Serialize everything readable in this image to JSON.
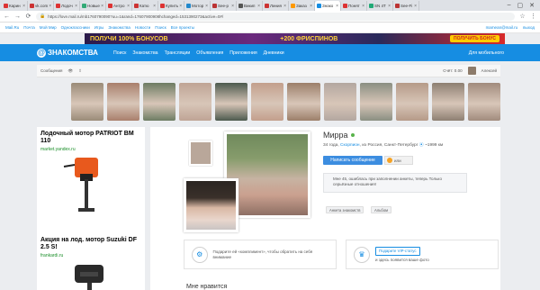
{
  "browser": {
    "tabs": [
      {
        "label": "Карин",
        "fav": "#d33"
      },
      {
        "label": "vk.com",
        "fav": "#c33"
      },
      {
        "label": "Лодоч",
        "fav": "#d33"
      },
      {
        "label": "Новые",
        "fav": "#3a7"
      },
      {
        "label": "Антро",
        "fav": "#d33"
      },
      {
        "label": "Катю",
        "fav": "#c33"
      },
      {
        "label": "Купить",
        "fav": "#d33"
      },
      {
        "label": "Мотор",
        "fav": "#28c"
      },
      {
        "label": "See-p",
        "fav": "#b33"
      },
      {
        "label": "Викип",
        "fav": "#555"
      },
      {
        "label": "Линия",
        "fav": "#c33"
      },
      {
        "label": "Заказ",
        "fav": "#f90"
      },
      {
        "label": "Знако",
        "fav": "#168de2"
      },
      {
        "label": "Понят",
        "fav": "#d33"
      },
      {
        "label": "SN 4Т",
        "fav": "#2a7"
      },
      {
        "label": "See-Fi",
        "fav": "#b33"
      }
    ],
    "url": "https://love.mail.ru/mb1760790090?uu=1&rand=17607900908hchanged=1531390273&active=0#/"
  },
  "portal": {
    "links": [
      "Mail.Ru",
      "Почта",
      "Мой Мир",
      "Одноклассники",
      "Игры",
      "Знакомства",
      "Новости",
      "Поиск",
      "Все проекты"
    ],
    "user": "mamean@mail.ru",
    "logout": "выход"
  },
  "banner": {
    "left": "ПОЛУЧИ 100% БОНУСОВ",
    "right": "+200 ФРИСПИНОВ",
    "button": "ПОЛУЧИТЬ БОНУС"
  },
  "nav": {
    "logo": "ЗНАКОМСТВА",
    "items": [
      "Поиск",
      "Знакомства",
      "Трансляции",
      "Объявления",
      "Приложения",
      "Дневники"
    ],
    "mobile": "Для мобильного"
  },
  "subbar": {
    "messages": "Сообщения",
    "balance": "Счёт: 0.00",
    "user": "Алексей"
  },
  "strip_colors": [
    "#9a8b78",
    "#a97f6c",
    "#6d7c63",
    "#bfa495",
    "#4c5a4e",
    "#c39f8c",
    "#9c7f6a",
    "#b3a7a0",
    "#8a8f82",
    "#b59a88",
    "#8d7f72",
    "#a18b7d"
  ],
  "ads": [
    {
      "title": "Лодочный мотор PATRIOT BM 110",
      "url": "market.yandex.ru"
    },
    {
      "title": "Акция на лод. мотор Suzuki DF 2.5 S!",
      "url": "frankardi.ru"
    }
  ],
  "profile": {
    "name": "Мирра",
    "age": "34 года,",
    "zodiac": "Скорпион",
    "loc_prefix": "из Россия, Санкт-Петербург",
    "distance": "~1999 км",
    "write": "Написать сообщение",
    "or": "или",
    "quote": "Мне 45, ошиблась при заполнении анкеты, теперь Только серьёзные отношения!",
    "chips": [
      "Анкета знакомств",
      "Альбом"
    ],
    "promo1": "Подарите ей «комплимент», чтобы обратить на себя внимание",
    "vip": "Подарите VIP-статус",
    "promo2": "и здесь появится ваше фото",
    "bottom": "Мне нравится"
  }
}
